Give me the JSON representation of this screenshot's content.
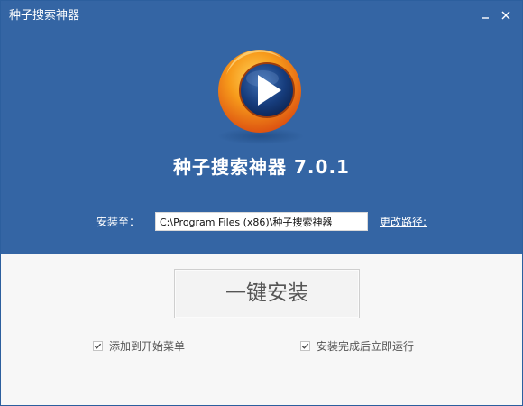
{
  "window": {
    "title": "种子搜索神器"
  },
  "app": {
    "name_version": "种子搜索神器 7.0.1"
  },
  "install": {
    "label": "安装至：",
    "path": "C:\\Program Files (x86)\\种子搜索神器",
    "change_path_label": "更改路径:"
  },
  "actions": {
    "install_button_label": "一键安装"
  },
  "options": [
    {
      "label": "添加到开始菜单",
      "checked": true
    },
    {
      "label": "安装完成后立即运行",
      "checked": true
    }
  ],
  "colors": {
    "header_bg": "#3465a4",
    "body_bg": "#f7f7f7",
    "text_light": "#ffffff",
    "text_dark": "#555555"
  },
  "icons": {
    "minimize": "minimize-icon",
    "close": "close-icon",
    "logo": "play-logo-icon",
    "checkbox": "checkbox-checked-icon"
  }
}
